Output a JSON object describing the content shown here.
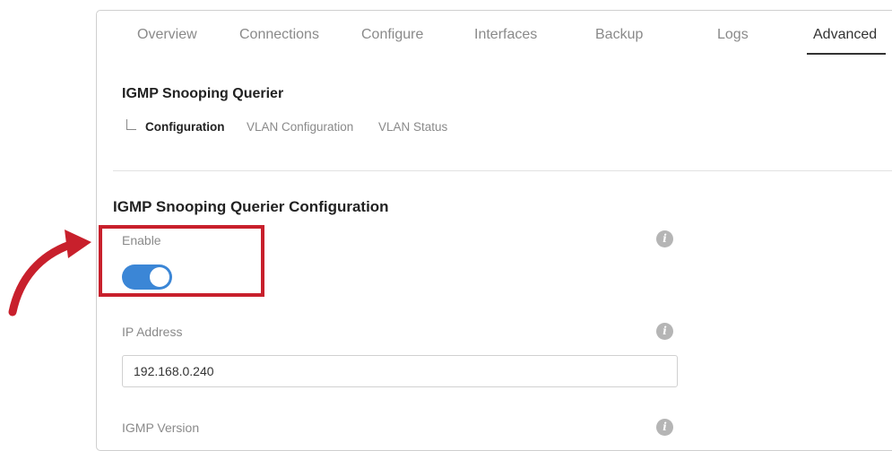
{
  "tabs": [
    {
      "label": "Overview"
    },
    {
      "label": "Connections"
    },
    {
      "label": "Configure"
    },
    {
      "label": "Interfaces"
    },
    {
      "label": "Backup"
    },
    {
      "label": "Logs"
    },
    {
      "label": "Advanced"
    }
  ],
  "active_tab": "Advanced",
  "page_title": "IGMP Snooping Querier",
  "subnav": [
    {
      "label": "Configuration"
    },
    {
      "label": "VLAN Configuration"
    },
    {
      "label": "VLAN Status"
    }
  ],
  "active_subnav": "Configuration",
  "section_title": "IGMP Snooping Querier Configuration",
  "fields": {
    "enable": {
      "label": "Enable",
      "state": "on"
    },
    "ip_address": {
      "label": "IP Address",
      "value": "192.168.0.240"
    },
    "igmp_version": {
      "label": "IGMP Version"
    }
  },
  "icons": {
    "info": "i"
  },
  "colors": {
    "accent": "#3b86d6",
    "highlight": "#c8202c",
    "annotation_arrow": "#c8202c"
  }
}
